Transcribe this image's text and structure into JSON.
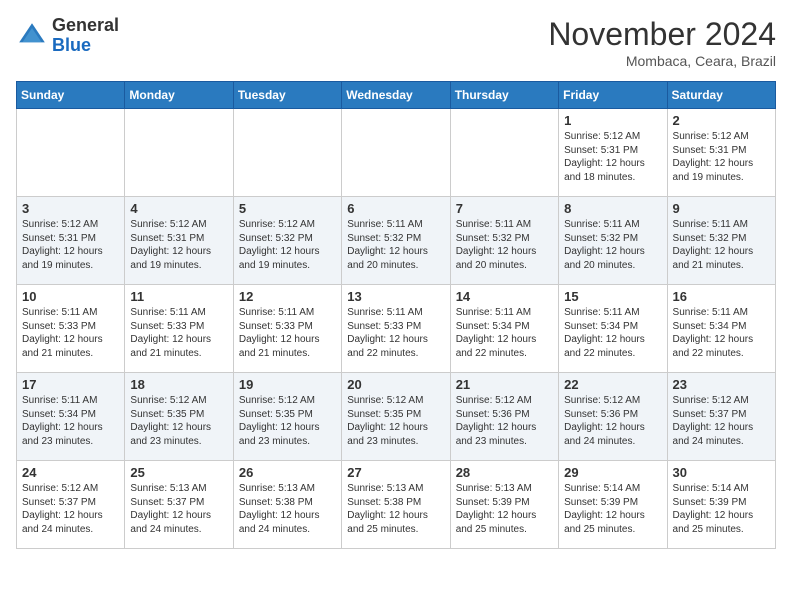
{
  "header": {
    "logo_line1": "General",
    "logo_line2": "Blue",
    "month": "November 2024",
    "location": "Mombaca, Ceara, Brazil"
  },
  "days_of_week": [
    "Sunday",
    "Monday",
    "Tuesday",
    "Wednesday",
    "Thursday",
    "Friday",
    "Saturday"
  ],
  "weeks": [
    [
      {
        "date": "",
        "info": ""
      },
      {
        "date": "",
        "info": ""
      },
      {
        "date": "",
        "info": ""
      },
      {
        "date": "",
        "info": ""
      },
      {
        "date": "",
        "info": ""
      },
      {
        "date": "1",
        "info": "Sunrise: 5:12 AM\nSunset: 5:31 PM\nDaylight: 12 hours\nand 18 minutes."
      },
      {
        "date": "2",
        "info": "Sunrise: 5:12 AM\nSunset: 5:31 PM\nDaylight: 12 hours\nand 19 minutes."
      }
    ],
    [
      {
        "date": "3",
        "info": "Sunrise: 5:12 AM\nSunset: 5:31 PM\nDaylight: 12 hours\nand 19 minutes."
      },
      {
        "date": "4",
        "info": "Sunrise: 5:12 AM\nSunset: 5:31 PM\nDaylight: 12 hours\nand 19 minutes."
      },
      {
        "date": "5",
        "info": "Sunrise: 5:12 AM\nSunset: 5:32 PM\nDaylight: 12 hours\nand 19 minutes."
      },
      {
        "date": "6",
        "info": "Sunrise: 5:11 AM\nSunset: 5:32 PM\nDaylight: 12 hours\nand 20 minutes."
      },
      {
        "date": "7",
        "info": "Sunrise: 5:11 AM\nSunset: 5:32 PM\nDaylight: 12 hours\nand 20 minutes."
      },
      {
        "date": "8",
        "info": "Sunrise: 5:11 AM\nSunset: 5:32 PM\nDaylight: 12 hours\nand 20 minutes."
      },
      {
        "date": "9",
        "info": "Sunrise: 5:11 AM\nSunset: 5:32 PM\nDaylight: 12 hours\nand 21 minutes."
      }
    ],
    [
      {
        "date": "10",
        "info": "Sunrise: 5:11 AM\nSunset: 5:33 PM\nDaylight: 12 hours\nand 21 minutes."
      },
      {
        "date": "11",
        "info": "Sunrise: 5:11 AM\nSunset: 5:33 PM\nDaylight: 12 hours\nand 21 minutes."
      },
      {
        "date": "12",
        "info": "Sunrise: 5:11 AM\nSunset: 5:33 PM\nDaylight: 12 hours\nand 21 minutes."
      },
      {
        "date": "13",
        "info": "Sunrise: 5:11 AM\nSunset: 5:33 PM\nDaylight: 12 hours\nand 22 minutes."
      },
      {
        "date": "14",
        "info": "Sunrise: 5:11 AM\nSunset: 5:34 PM\nDaylight: 12 hours\nand 22 minutes."
      },
      {
        "date": "15",
        "info": "Sunrise: 5:11 AM\nSunset: 5:34 PM\nDaylight: 12 hours\nand 22 minutes."
      },
      {
        "date": "16",
        "info": "Sunrise: 5:11 AM\nSunset: 5:34 PM\nDaylight: 12 hours\nand 22 minutes."
      }
    ],
    [
      {
        "date": "17",
        "info": "Sunrise: 5:11 AM\nSunset: 5:34 PM\nDaylight: 12 hours\nand 23 minutes."
      },
      {
        "date": "18",
        "info": "Sunrise: 5:12 AM\nSunset: 5:35 PM\nDaylight: 12 hours\nand 23 minutes."
      },
      {
        "date": "19",
        "info": "Sunrise: 5:12 AM\nSunset: 5:35 PM\nDaylight: 12 hours\nand 23 minutes."
      },
      {
        "date": "20",
        "info": "Sunrise: 5:12 AM\nSunset: 5:35 PM\nDaylight: 12 hours\nand 23 minutes."
      },
      {
        "date": "21",
        "info": "Sunrise: 5:12 AM\nSunset: 5:36 PM\nDaylight: 12 hours\nand 23 minutes."
      },
      {
        "date": "22",
        "info": "Sunrise: 5:12 AM\nSunset: 5:36 PM\nDaylight: 12 hours\nand 24 minutes."
      },
      {
        "date": "23",
        "info": "Sunrise: 5:12 AM\nSunset: 5:37 PM\nDaylight: 12 hours\nand 24 minutes."
      }
    ],
    [
      {
        "date": "24",
        "info": "Sunrise: 5:12 AM\nSunset: 5:37 PM\nDaylight: 12 hours\nand 24 minutes."
      },
      {
        "date": "25",
        "info": "Sunrise: 5:13 AM\nSunset: 5:37 PM\nDaylight: 12 hours\nand 24 minutes."
      },
      {
        "date": "26",
        "info": "Sunrise: 5:13 AM\nSunset: 5:38 PM\nDaylight: 12 hours\nand 24 minutes."
      },
      {
        "date": "27",
        "info": "Sunrise: 5:13 AM\nSunset: 5:38 PM\nDaylight: 12 hours\nand 25 minutes."
      },
      {
        "date": "28",
        "info": "Sunrise: 5:13 AM\nSunset: 5:39 PM\nDaylight: 12 hours\nand 25 minutes."
      },
      {
        "date": "29",
        "info": "Sunrise: 5:14 AM\nSunset: 5:39 PM\nDaylight: 12 hours\nand 25 minutes."
      },
      {
        "date": "30",
        "info": "Sunrise: 5:14 AM\nSunset: 5:39 PM\nDaylight: 12 hours\nand 25 minutes."
      }
    ]
  ]
}
